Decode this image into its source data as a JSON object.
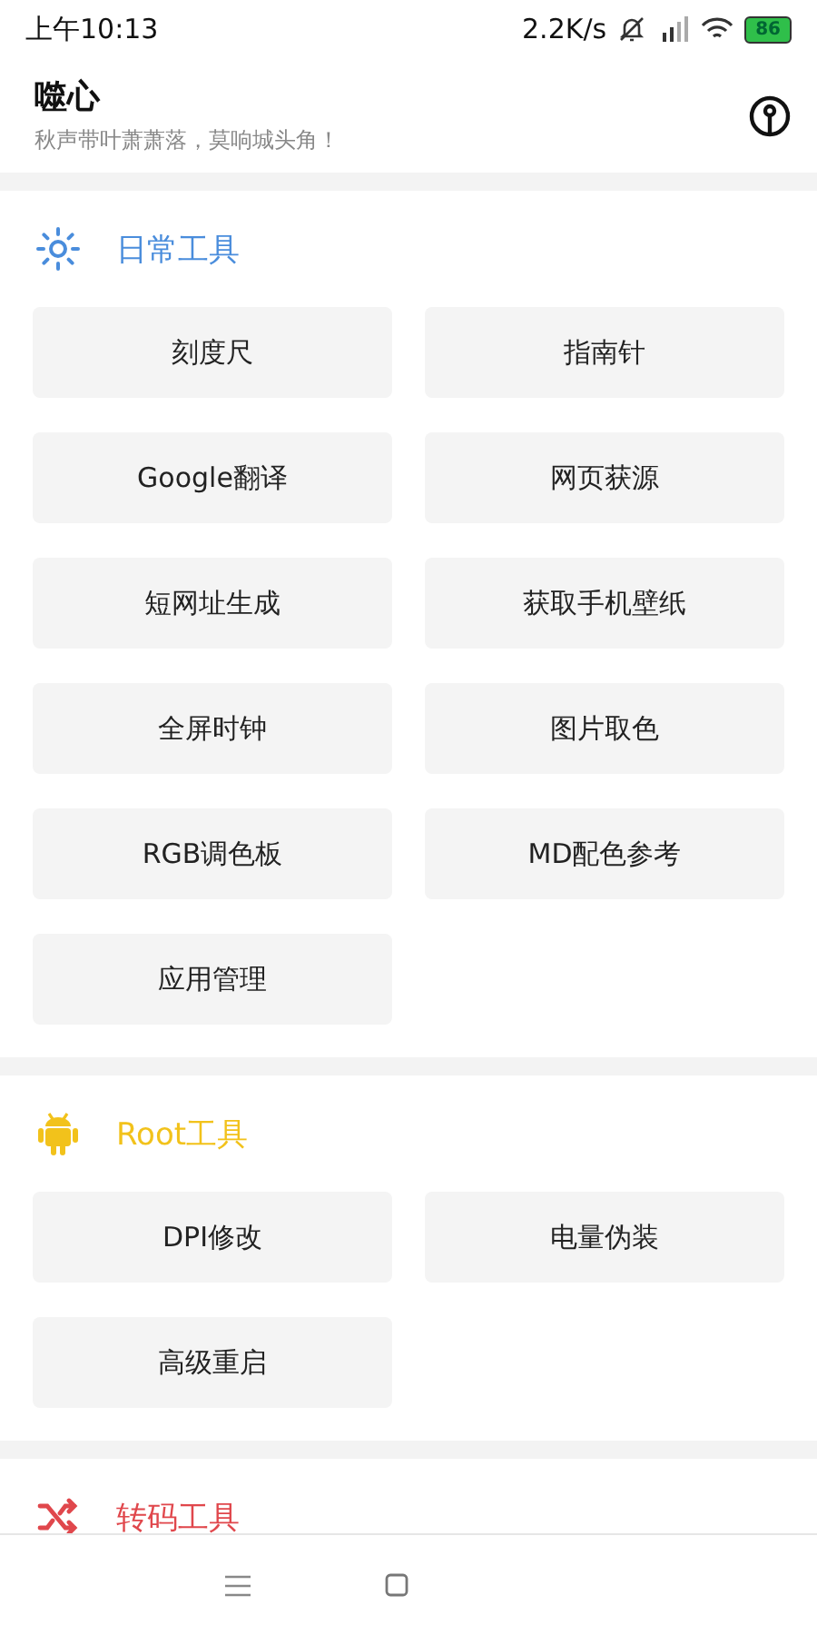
{
  "status_bar": {
    "time": "上午10:13",
    "net_speed": "2.2K/s",
    "battery": "86"
  },
  "header": {
    "title": "噬心",
    "subtitle": "秋声带叶萧萧落，莫响城头角！"
  },
  "sections": [
    {
      "title": "日常工具",
      "kind": "sun",
      "color": "#4a8ddc",
      "tools": [
        "刻度尺",
        "指南针",
        "Google翻译",
        "网页获源",
        "短网址生成",
        "获取手机壁纸",
        "全屏时钟",
        "图片取色",
        "RGB调色板",
        "MD配色参考",
        "应用管理"
      ]
    },
    {
      "title": "Root工具",
      "kind": "android",
      "color": "#f2c21b",
      "tools": [
        "DPI修改",
        "电量伪装",
        "高级重启"
      ]
    },
    {
      "title": "转码工具",
      "kind": "shuffle",
      "color": "#e0474c"
    }
  ]
}
